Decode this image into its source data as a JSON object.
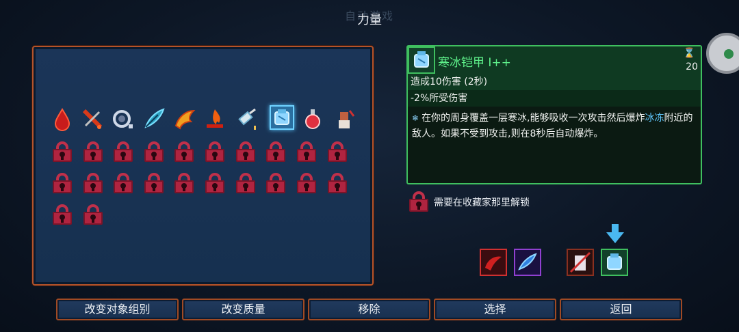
{
  "header": {
    "title": "力量",
    "ghost_title": "自动游戏"
  },
  "grid": {
    "slot_names": [
      "blood-drop-mutation-icon",
      "syringe-mutation-icon",
      "combo-mutation-icon",
      "feather-mutation-icon",
      "flame-wing-mutation-icon",
      "fire-mutation-icon",
      "vial-mutation-icon",
      "frost-armor-mutation-icon",
      "potion-mutation-icon",
      "warrior-mutation-icon"
    ],
    "selected_index": 7,
    "locked_count": 22
  },
  "detail": {
    "title": "寒冰铠甲 I++",
    "cost": "20",
    "stat1": "造成10伤害 (2秒)",
    "stat2": "-2%所受伤害",
    "desc_part1": "在你的周身覆盖一层寒冰,能够吸收一次攻击然后爆炸",
    "desc_highlight": "冰冻",
    "desc_part2": "附近的敌人。如果不受到攻击,则在8秒后自动爆炸。"
  },
  "unlock": {
    "text": "需要在收藏家那里解锁"
  },
  "equipped": [
    "red-mutation-slot-icon",
    "purple-mutation-slot-icon",
    "brown-mutation-slot-icon",
    "green-mutation-slot-icon"
  ],
  "buttons": {
    "change_group": "改变对象组别",
    "change_quality": "改变质量",
    "remove": "移除",
    "select": "选择",
    "back": "返回"
  },
  "colors": {
    "accent_green": "#3fbf5f",
    "panel_border": "#b4532a",
    "highlight_blue": "#5fc8ff"
  }
}
